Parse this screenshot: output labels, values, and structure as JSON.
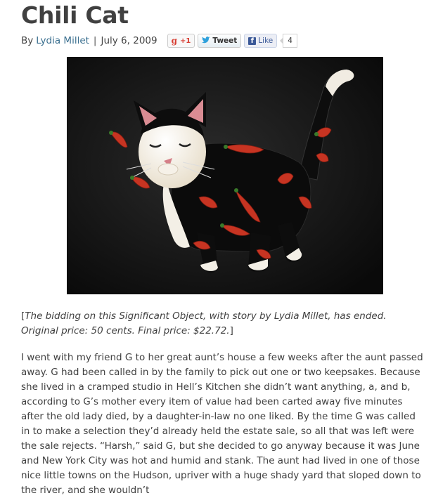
{
  "post": {
    "title": "Chili Cat",
    "byline_prefix": "By",
    "author": "Lydia Millet",
    "separator": "|",
    "date": "July 6, 2009"
  },
  "social": {
    "gplus_label": "+1",
    "tweet_label": "Tweet",
    "like_label": "Like",
    "like_count": "4"
  },
  "caption": {
    "open_bracket": "[",
    "italic_text": "The bidding on this Significant Object, with story by Lydia Millet, has ended. Original price: 50 cents. Final price: $22.72.",
    "close_bracket": "]"
  },
  "body": {
    "paragraph": "I went with my friend G to her great aunt’s house a few weeks after the aunt passed away. G had been called in by the family to pick out one or two keepsakes. Because she lived in a cramped studio in Hell’s Kitchen she didn’t want anything, a, and b, according to G’s mother every item of value had been carted away five minutes after the old lady died, by a daughter-in-law no one liked. By the time G was called in to make a selection they’d already held the estate sale, so all that was left were the sale rejects. “Harsh,” said G, but she decided to go anyway because it was June and New York City was hot and humid and stank. The aunt had lived in one of those nice little towns on the Hudson, upriver with a huge shady yard that sloped down to the river, and she wouldn’t"
  }
}
